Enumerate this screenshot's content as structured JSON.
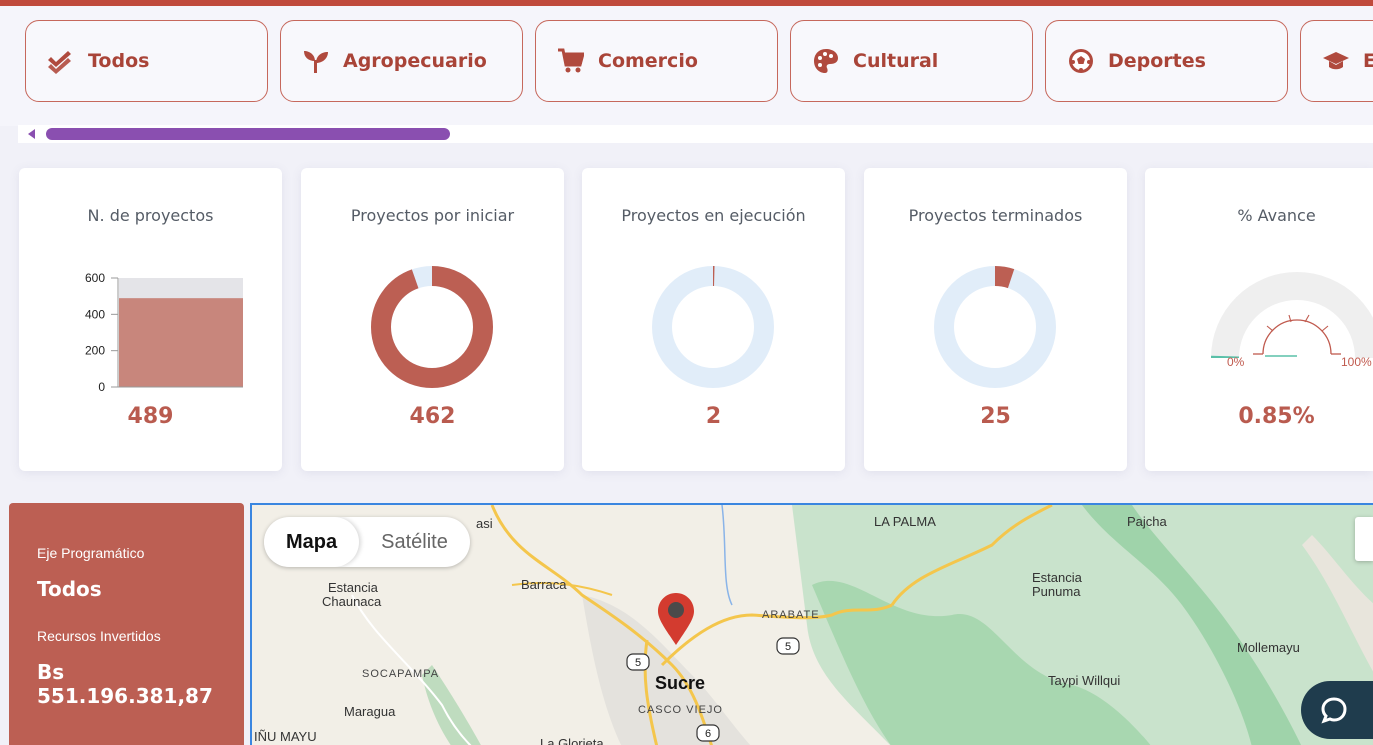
{
  "categories": [
    {
      "label": "Todos",
      "icon": "double-check-icon"
    },
    {
      "label": "Agropecuario",
      "icon": "sprout-icon"
    },
    {
      "label": "Comercio",
      "icon": "cart-icon"
    },
    {
      "label": "Cultural",
      "icon": "palette-icon"
    },
    {
      "label": "Deportes",
      "icon": "soccer-ball-icon"
    },
    {
      "label": "E",
      "icon": "graduation-cap-icon"
    }
  ],
  "colors": {
    "accent": "#bc5f53",
    "scroll": "#8a4fb0",
    "donut_bg": "#e1edf9",
    "map_border": "#3a86e0"
  },
  "cards": {
    "n_proyectos": {
      "title": "N. de proyectos",
      "value": "489"
    },
    "por_iniciar": {
      "title": "Proyectos por iniciar",
      "value": "462"
    },
    "en_ejecucion": {
      "title": "Proyectos en ejecución",
      "value": "2"
    },
    "terminados": {
      "title": "Proyectos terminados",
      "value": "25"
    },
    "avance": {
      "title": "% Avance",
      "value": "0.85%",
      "min_label": "0%",
      "max_label": "100%"
    }
  },
  "bar_chart": {
    "ticks": [
      "600",
      "400",
      "200",
      "0"
    ],
    "max": 600,
    "value": 489
  },
  "donuts": {
    "total": 489,
    "por_iniciar": 462,
    "en_ejecucion": 2,
    "terminados": 25
  },
  "gauge": {
    "value_percent": 0.85
  },
  "summary": {
    "eje_label": "Eje Programático",
    "eje_value": "Todos",
    "recursos_label": "Recursos Invertidos",
    "recursos_value": "Bs 551.196.381,87"
  },
  "map": {
    "type_map": "Mapa",
    "type_satellite": "Satélite",
    "labels": {
      "asi": "asi",
      "la_palma": "LA PALMA",
      "pajcha": "Pajcha",
      "estancia_chaunaca_1": "Estancia",
      "estancia_chaunaca_2": "Chaunaca",
      "barraca": "Barraca",
      "arabate": "ARABATE",
      "estancia_punuma_1": "Estancia",
      "estancia_punuma_2": "Punuma",
      "mollemayu": "Mollemayu",
      "socapampa": "SOCAPAMPA",
      "sucre": "Sucre",
      "taypi_willqui": "Taypi Willqui",
      "casco_viejo": "CASCO VIEJO",
      "maragua": "Maragua",
      "nu_mayu": "IÑU MAYU",
      "la_glorieta": "La Glorieta",
      "route_5a": "5",
      "route_5b": "5",
      "route_6": "6"
    },
    "chat_label": "C"
  }
}
